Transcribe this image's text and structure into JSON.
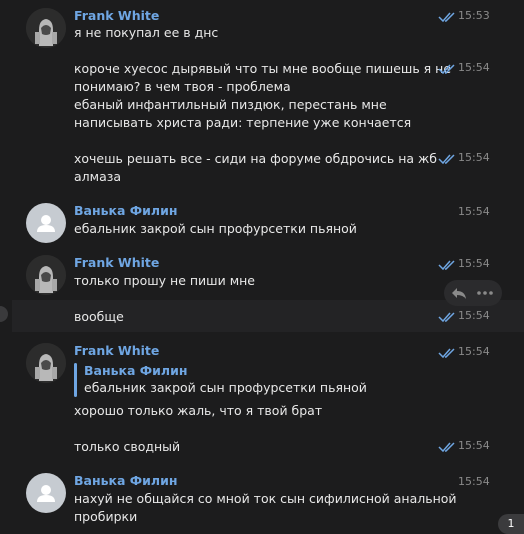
{
  "colors": {
    "background": "#1c1c1d",
    "sender_name": "#6fa6e3",
    "read_check": "#6fa6e3",
    "text": "#e8e8e8",
    "timestamp": "#8a8a8a"
  },
  "messages": [
    {
      "sender": "Frank White",
      "text": "я не покупал ее в днс",
      "time": "15:53",
      "read": true
    },
    {
      "text": [
        "короче хуесос дырявый что ты мне вообще пишешь я не",
        "понимаю? в чем твоя - проблема",
        "ебаный инфантильный пиздюк, перестань мне",
        "написывать христа ради: терпение уже кончается"
      ],
      "time": "15:54",
      "read": true
    },
    {
      "text": [
        "хочешь решать все - сиди на форуме обдрочись на жб",
        "алмаза"
      ],
      "time": "15:54",
      "read": true
    },
    {
      "sender": "Ванька Филин",
      "text": "ебальник закрой сын профурсетки пьяной",
      "time": "15:54",
      "read": false
    },
    {
      "sender": "Frank White",
      "text": "только прошу не пиши мне",
      "time": "15:54",
      "read": true
    },
    {
      "text": "вообще",
      "time": "15:54",
      "read": true,
      "hovered": true
    },
    {
      "sender": "Frank White",
      "reply_to": {
        "sender": "Ванька Филин",
        "text": "ебальник закрой сын профурсетки пьяной"
      },
      "text": "хорошо только жаль, что я твой брат",
      "time": "15:54",
      "read": true
    },
    {
      "text": "только сводный",
      "time": "15:54",
      "read": true
    },
    {
      "sender": "Ванька Филин",
      "text": [
        "нахуй не общайся со мной ток сын сифилисной анальной",
        "пробирки"
      ],
      "time": "15:54",
      "read": false
    }
  ],
  "hover_actions": [
    "reply-icon",
    "more-icon"
  ],
  "unread_badge": "1"
}
